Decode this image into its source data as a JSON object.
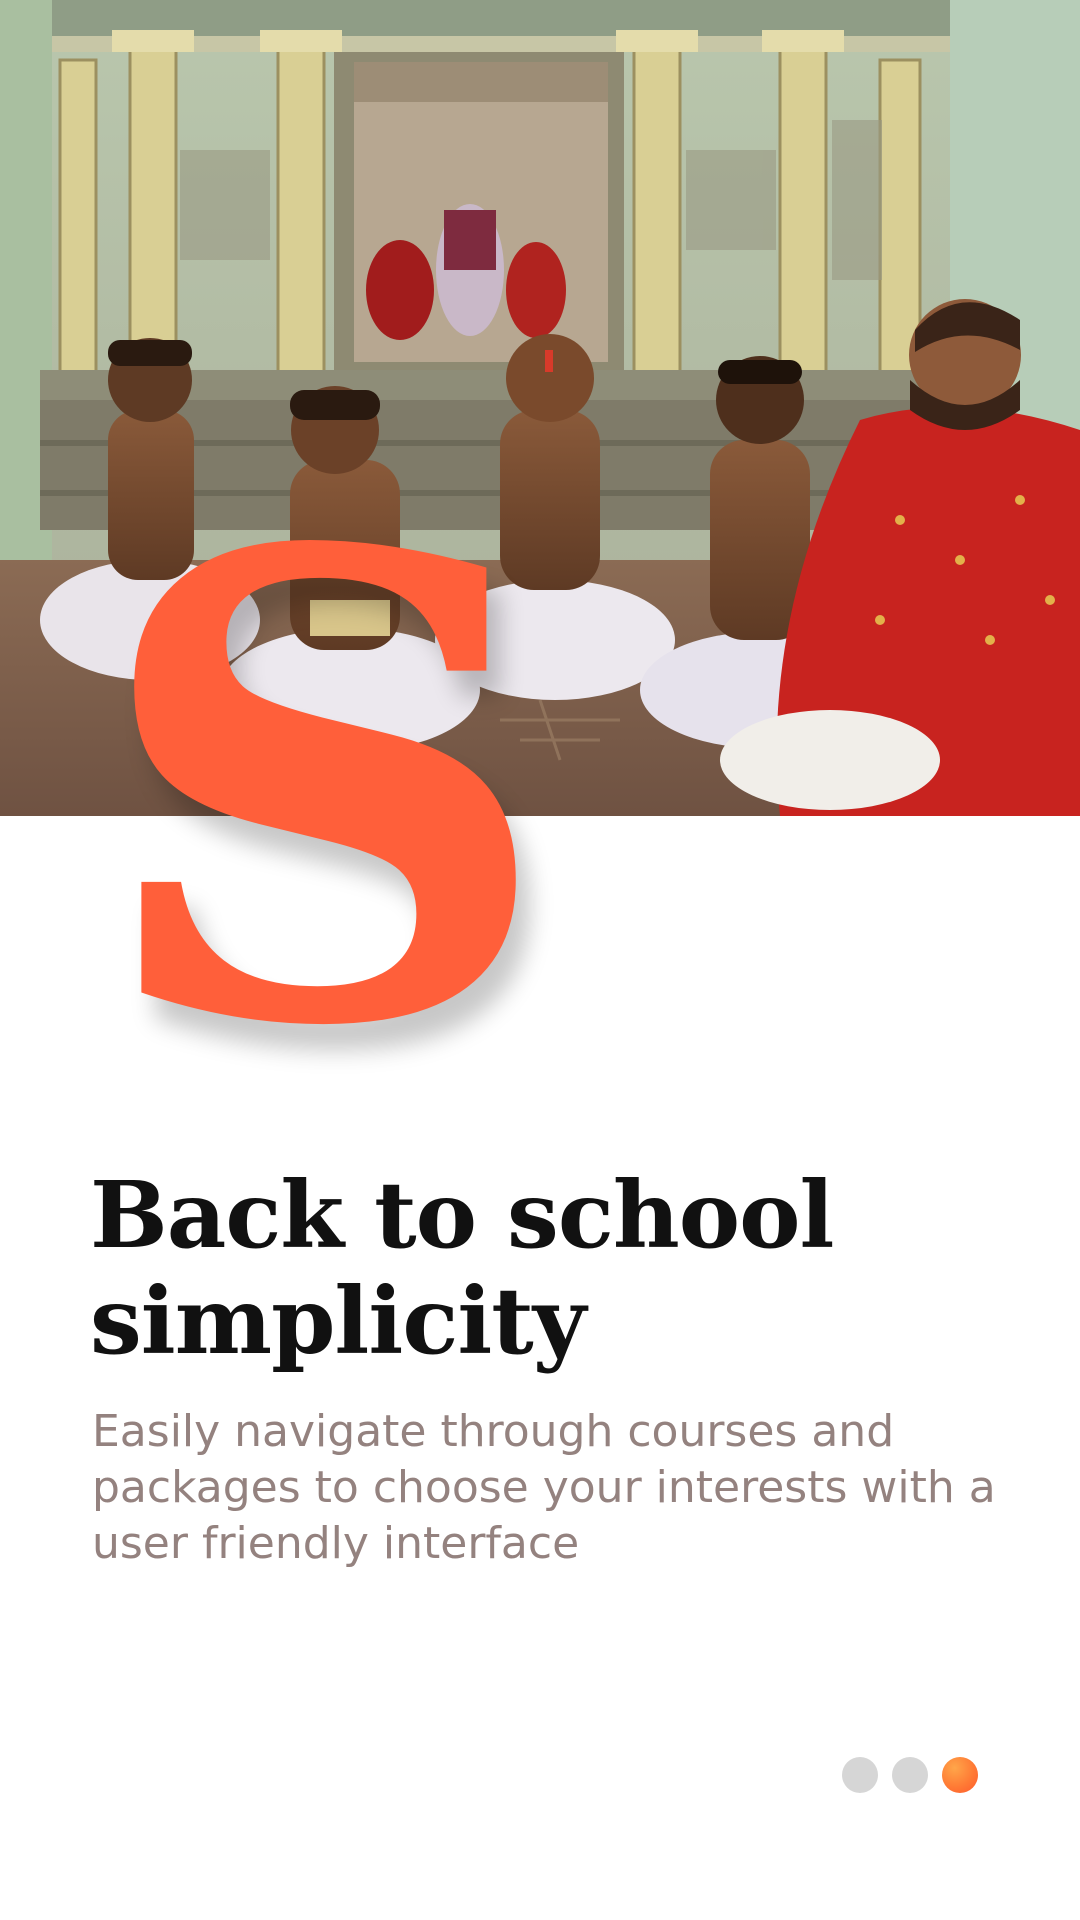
{
  "onboarding": {
    "hero_image": {
      "icon": "photo-students-seated-before-teacher"
    },
    "drop_cap": "S",
    "title_lines": [
      "Back to school",
      "simplicity"
    ],
    "description": "Easily navigate through courses and packages to choose your interests with a user friendly interface",
    "pager": {
      "total": 3,
      "active_index": 2
    }
  },
  "colors": {
    "accent": "#ff5f3a",
    "title": "#111111",
    "description": "#94827f",
    "dot_inactive": "#d6d6d6",
    "dot_active": "#ff7b35"
  }
}
